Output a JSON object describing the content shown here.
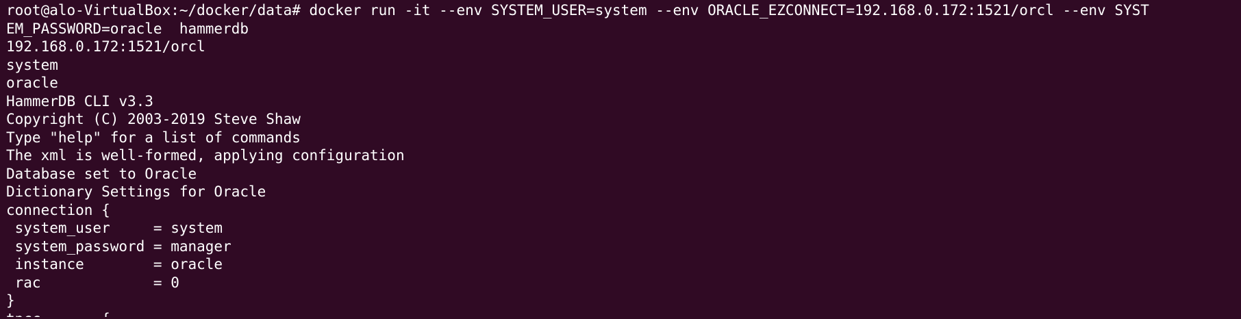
{
  "terminal": {
    "lines": [
      "root@alo-VirtualBox:~/docker/data# docker run -it --env SYSTEM_USER=system --env ORACLE_EZCONNECT=192.168.0.172:1521/orcl --env SYST",
      "EM_PASSWORD=oracle  hammerdb",
      "192.168.0.172:1521/orcl",
      "system",
      "oracle",
      "HammerDB CLI v3.3",
      "Copyright (C) 2003-2019 Steve Shaw",
      "Type \"help\" for a list of commands",
      "The xml is well-formed, applying configuration",
      "Database set to Oracle",
      "Dictionary Settings for Oracle",
      "connection {",
      " system_user     = system",
      " system_password = manager",
      " instance        = oracle",
      " rac             = 0",
      "}",
      "tpcc       {"
    ]
  }
}
